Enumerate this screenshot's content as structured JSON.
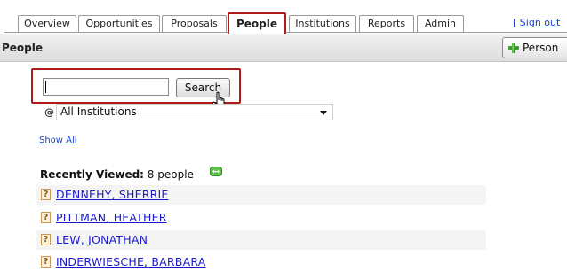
{
  "tabs": [
    {
      "label": "Overview",
      "active": false
    },
    {
      "label": "Opportunities",
      "active": false
    },
    {
      "label": "Proposals",
      "active": false
    },
    {
      "label": "People",
      "active": true
    },
    {
      "label": "Institutions",
      "active": false
    },
    {
      "label": "Reports",
      "active": false
    },
    {
      "label": "Admin",
      "active": false
    }
  ],
  "signout": {
    "open_bracket": "[",
    "label": "Sign out"
  },
  "header": {
    "title": "People",
    "person_button": "Person"
  },
  "search": {
    "input_value": "",
    "button_label": "Search"
  },
  "filter": {
    "at_symbol": "@",
    "selected": "All Institutions"
  },
  "show_all": "Show All",
  "recent": {
    "label": "Recently Viewed:",
    "count_text": "8 people"
  },
  "people": [
    {
      "badge": "?",
      "name": "DENNEHY, SHERRIE"
    },
    {
      "badge": "?",
      "name": "PITTMAN, HEATHER"
    },
    {
      "badge": "?",
      "name": "LEW, JONATHAN"
    },
    {
      "badge": "?",
      "name": "INDERWIESCHE, BARBARA"
    }
  ],
  "colors": {
    "highlight": "#b01c1c",
    "link": "#1a1acc",
    "accent_green": "#3aa02a"
  }
}
